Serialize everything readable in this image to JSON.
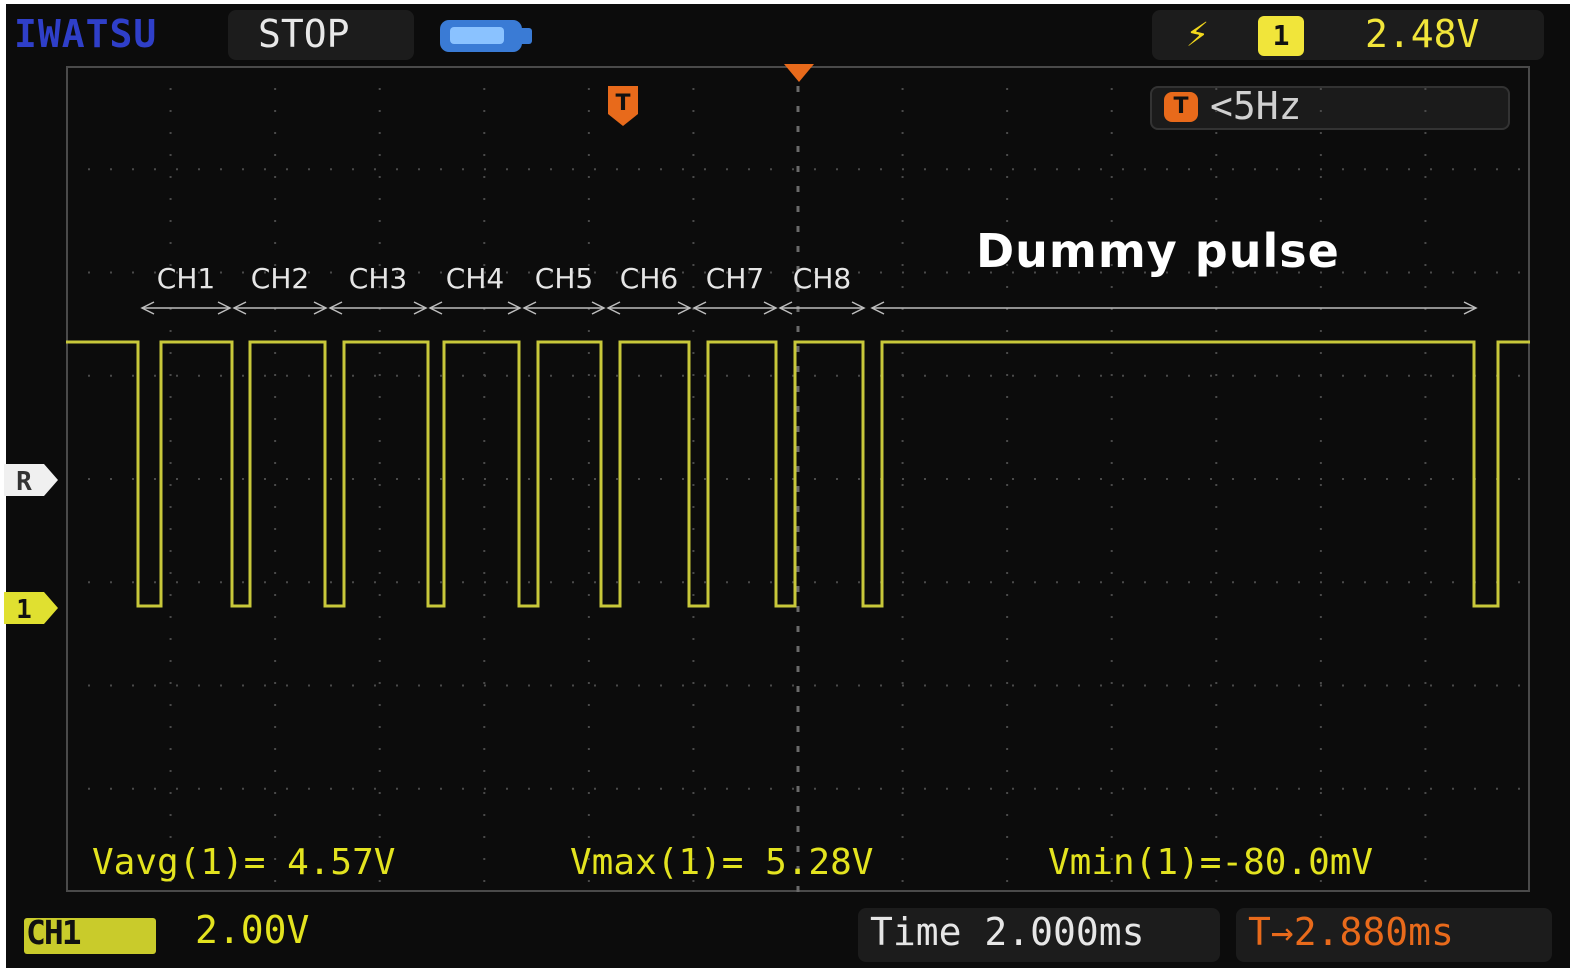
{
  "status_bar": {
    "brand": "IWATSU",
    "run_state": "STOP",
    "battery_icon": "battery-icon",
    "trigger_edge_icon": "rising-edge-icon",
    "trigger_source": "1",
    "trigger_level": "2.48V",
    "trigger_freq_badge": "T",
    "trigger_freq": "<5Hz"
  },
  "markers": {
    "trigger_position": "T",
    "reference": "R",
    "channel": "1"
  },
  "channel_labels": [
    "CH1",
    "CH2",
    "CH3",
    "CH4",
    "CH5",
    "CH6",
    "CH7",
    "CH8"
  ],
  "annotation": "Dummy pulse",
  "measurements": {
    "avg": "Vavg(1)= 4.57V",
    "max": "Vmax(1)= 5.28V",
    "min": "Vmin(1)=-80.0mV"
  },
  "bottom_bar": {
    "channel_badge": "CH1",
    "channel_scale": "2.00V",
    "time_label": "Time 2.000ms",
    "trigger_offset": "→2.880ms"
  },
  "colors": {
    "trace": "#c8c83a",
    "trigger": "#e86a1b",
    "brand": "#2f3fc9",
    "background": "#0c0c0c"
  }
}
